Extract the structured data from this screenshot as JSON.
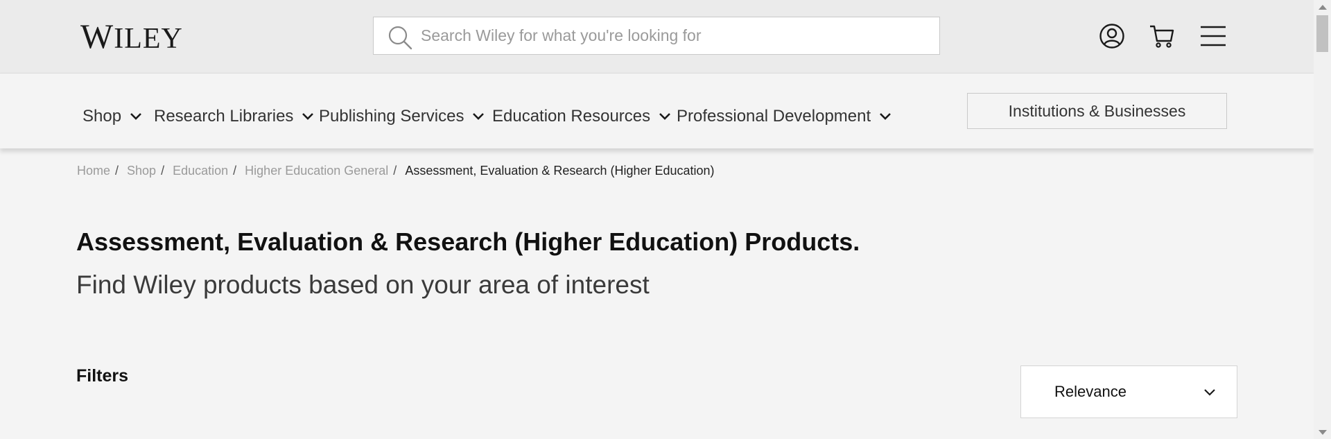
{
  "header": {
    "logo_first": "W",
    "logo_rest": "ILEY",
    "search_placeholder": "Search Wiley for what you're looking for",
    "icons": [
      "search-icon",
      "account-icon",
      "cart-icon",
      "menu-icon"
    ]
  },
  "nav": {
    "items": [
      {
        "label": "Shop"
      },
      {
        "label": "Research Libraries"
      },
      {
        "label": "Publishing Services"
      },
      {
        "label": "Education Resources"
      },
      {
        "label": "Professional Development"
      }
    ],
    "institutions_label": "Institutions & Businesses"
  },
  "breadcrumb": {
    "items": [
      "Home",
      "Shop",
      "Education",
      "Higher Education General"
    ],
    "separator": "/",
    "current": "Assessment, Evaluation & Research (Higher Education)"
  },
  "main": {
    "title": "Assessment, Evaluation & Research (Higher Education) Products.",
    "subtitle": "Find Wiley products based on your area of interest",
    "filters_label": "Filters",
    "sort_value": "Relevance"
  },
  "colors": {
    "topbar_bg": "#ebebeb",
    "page_bg": "#f4f4f4",
    "text_dark": "#111111",
    "breadcrumb_muted": "#9a9a9a"
  }
}
